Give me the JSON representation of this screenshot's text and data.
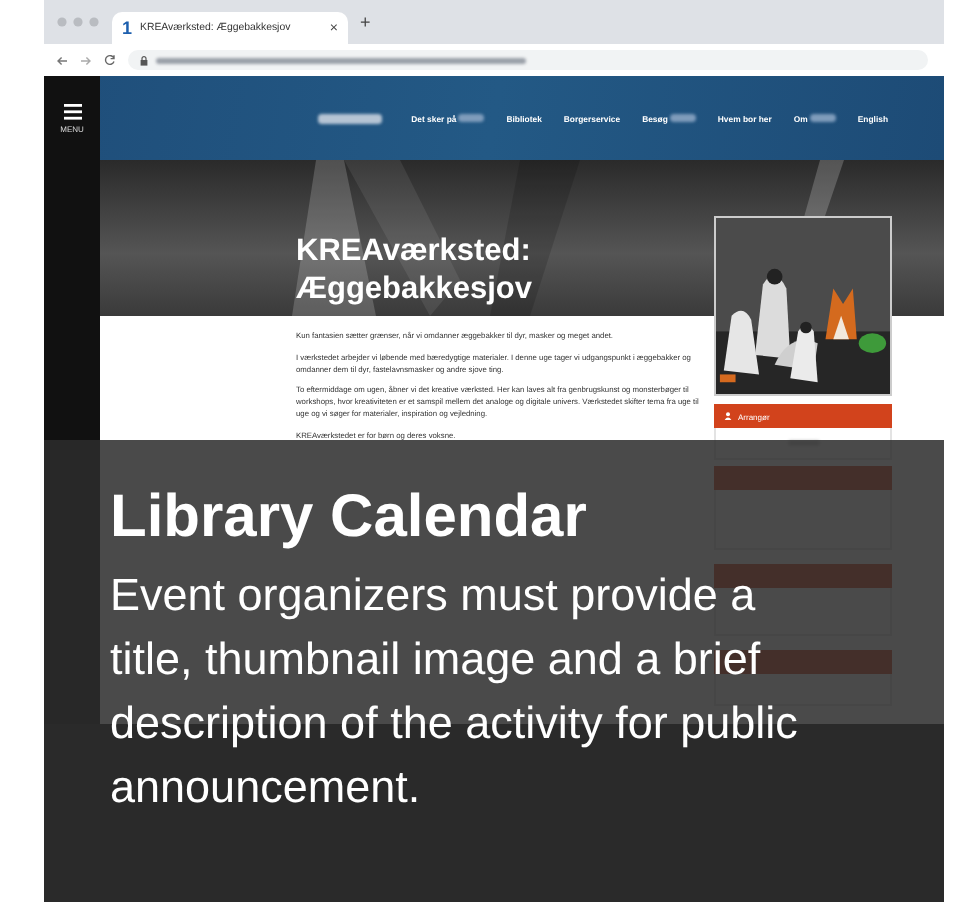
{
  "browser": {
    "tab": {
      "favicon": "1",
      "title": "KREAværksted: Æggebakkesjov",
      "close": "×"
    },
    "new_tab": "+"
  },
  "site_nav": {
    "menu_label": "MENU",
    "items": [
      {
        "label": "Det sker på",
        "redacted_suffix": true
      },
      {
        "label": "Bibliotek",
        "redacted_suffix": false
      },
      {
        "label": "Borgerservice",
        "redacted_suffix": false
      },
      {
        "label": "Besøg",
        "redacted_suffix": true
      },
      {
        "label": "Hvem bor her",
        "redacted_suffix": false
      },
      {
        "label": "Om",
        "redacted_suffix": true
      },
      {
        "label": "English",
        "redacted_suffix": false
      }
    ]
  },
  "event": {
    "title": "KREAværksted: Æggebakkesjov",
    "paragraphs": [
      "Kun fantasien sætter grænser, når vi omdanner æggebakker til dyr, masker og meget andet.",
      "I værkstedet arbejder vi løbende med bæredygtige materialer. I denne uge tager vi udgangspunkt i æggebakker og omdanner dem til dyr, fastelavnsmasker og andre sjove ting.",
      "To eftermiddage om ugen, åbner vi det kreative værksted. Her kan laves alt fra genbrugskunst og monsterbøger til workshops, hvor kreativiteten er et samspil mellem det analoge og digitale univers. Værkstedet skifter tema fra uge til uge og vi søger for materialer, inspiration og vejledning.",
      "KREAværkstedet er for børn og deres voksne."
    ]
  },
  "info": {
    "organizer": {
      "heading": "Arrangør"
    }
  },
  "caption": {
    "title": "Library Calendar",
    "text": "Event organizers must provide a title, thumbnail image and a brief description of the activity for public announcement."
  }
}
